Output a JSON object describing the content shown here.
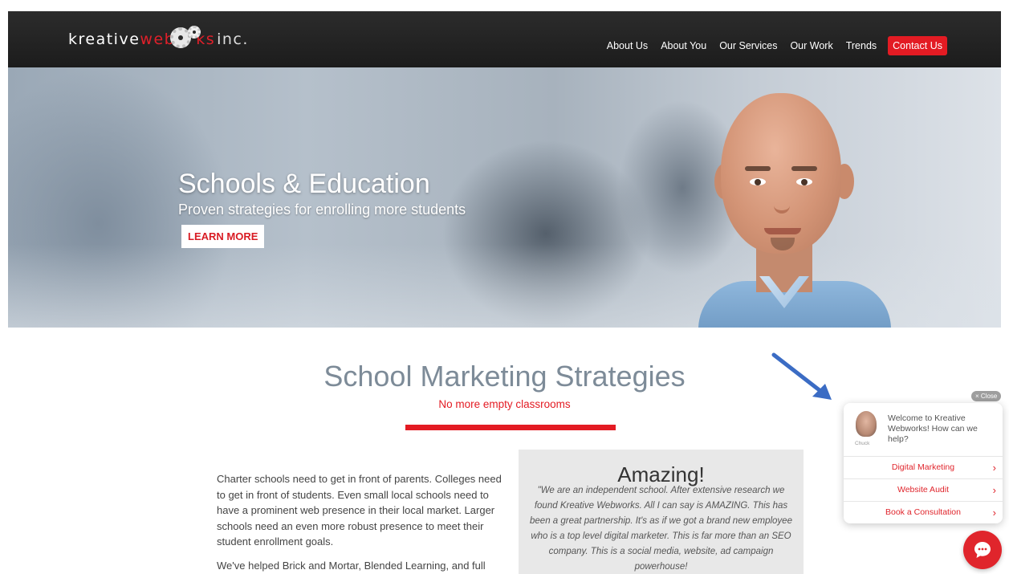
{
  "header": {
    "logo": {
      "word1": "kreative",
      "word2_red_a": "web",
      "word2_red_b": "ks",
      "suffix": "inc."
    },
    "nav": [
      {
        "label": "About Us"
      },
      {
        "label": "About You"
      },
      {
        "label": "Our Services"
      },
      {
        "label": "Our Work"
      },
      {
        "label": "Trends"
      }
    ],
    "contact_label": "Contact Us",
    "accent_color": "#e31b23"
  },
  "hero": {
    "title": "Schools & Education",
    "subtitle": "Proven strategies for enrolling more students",
    "button_label": "LEARN MORE"
  },
  "section": {
    "title": "School Marketing Strategies",
    "subtitle": "No more empty classrooms",
    "paragraphs": [
      "Charter schools need to get in front of parents. Colleges need to get in front of students. Even small local schools need to have a prominent web presence in their local market. Larger schools need an even more robust presence to meet their student enrollment goals.",
      "We've helped Brick and Mortar, Blended Learning, and full"
    ]
  },
  "testimonial": {
    "title": "Amazing!",
    "text": "\"We are an independent school. After extensive research we found Kreative Webworks. All I can say is AMAZING. This has been a great partnership. It's as if we got a brand new employee who is a top level digital marketer. This is far more than an SEO company. This is a social media, website, ad campaign powerhouse!"
  },
  "chat": {
    "close_label": "× Close",
    "agent_name": "Chuck",
    "welcome": "Welcome to Kreative Webworks! How can we help?",
    "options": [
      {
        "label": "Digital Marketing"
      },
      {
        "label": "Website Audit"
      },
      {
        "label": "Book a Consultation"
      }
    ],
    "chevron": "›"
  }
}
